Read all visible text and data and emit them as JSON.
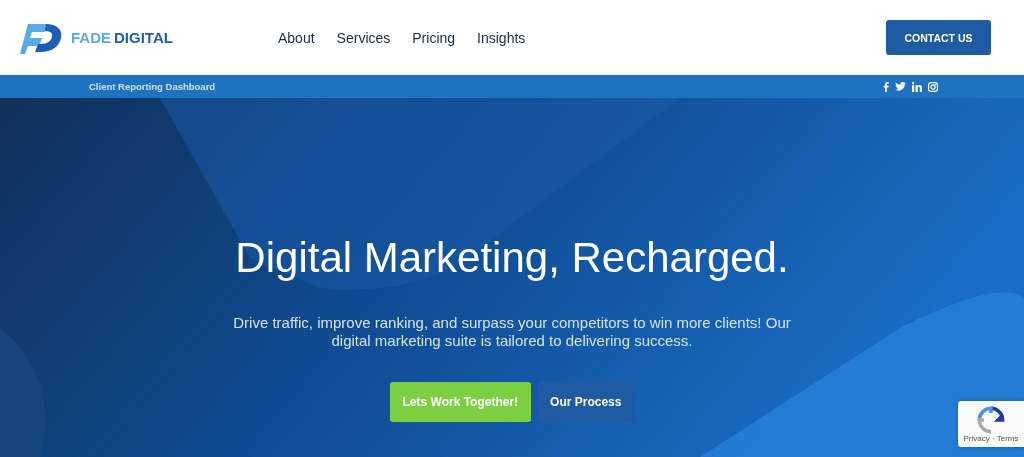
{
  "header": {
    "logo": {
      "word_1": "FADE",
      "word_2": "DIGITAL"
    },
    "nav": [
      {
        "label": "About"
      },
      {
        "label": "Services"
      },
      {
        "label": "Pricing"
      },
      {
        "label": "Insights"
      }
    ],
    "contact_button": "CONTACT US"
  },
  "top_bar": {
    "link": "Client Reporting Dashboard",
    "social": [
      {
        "kind": "facebook"
      },
      {
        "kind": "twitter"
      },
      {
        "kind": "linkedin"
      },
      {
        "kind": "instagram"
      }
    ]
  },
  "hero": {
    "title": "Digital Marketing, Recharged.",
    "subtitle": "Drive traffic, improve ranking, and surpass your competitors to win more clients! Our digital marketing suite is tailored to delivering success.",
    "buttons": [
      {
        "label": "Lets Work Together!",
        "kind": "primary"
      },
      {
        "label": "Our Process",
        "kind": "secondary"
      }
    ]
  },
  "recaptcha": {
    "text": "Privacy · Terms"
  }
}
